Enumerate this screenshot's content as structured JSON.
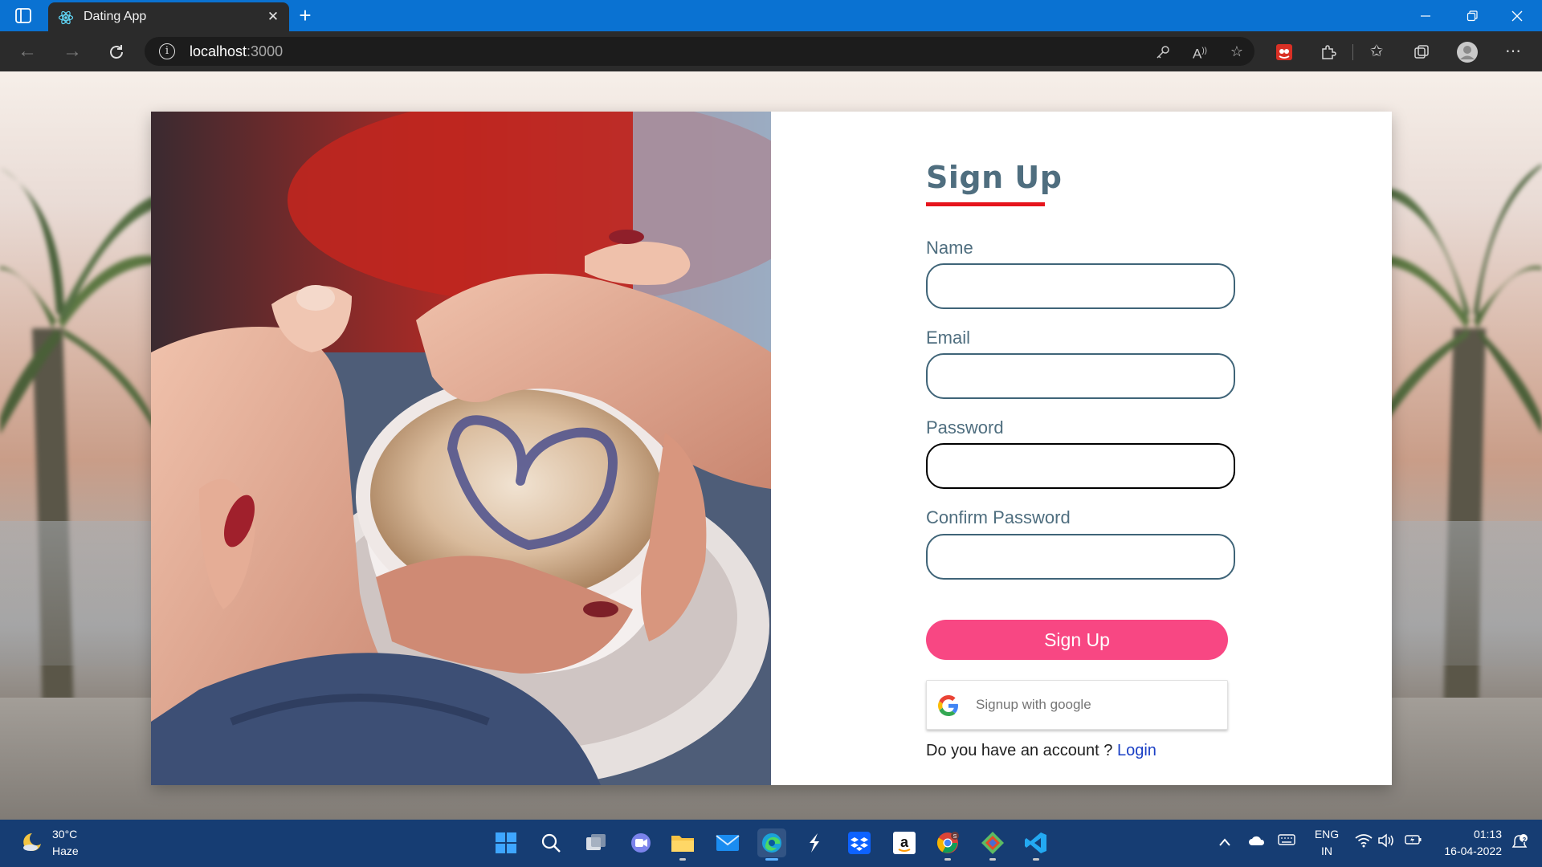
{
  "browser": {
    "tab_title": "Dating App",
    "url_host": "localhost",
    "url_port": ":3000"
  },
  "icons": {
    "tab_actions": "tab-actions-icon",
    "favicon": "react-icon",
    "close": "close-icon",
    "new_tab": "plus-icon",
    "back": "back-arrow-icon",
    "forward": "forward-arrow-icon",
    "refresh": "refresh-icon",
    "info": "info-icon",
    "key": "key-icon",
    "read_aloud": "read-aloud-icon",
    "add_favorite": "add-favorite-icon",
    "extension_red": "extension-icon",
    "extensions": "puzzle-icon",
    "favorites": "favorites-icon",
    "collections": "collections-icon",
    "profile": "profile-icon",
    "more": "more-icon",
    "google": "google-g-icon"
  },
  "form": {
    "title": "Sign Up",
    "name_label": "Name",
    "email_label": "Email",
    "password_label": "Password",
    "confirm_label": "Confirm Password",
    "name_value": "",
    "email_value": "",
    "password_value": "",
    "confirm_value": "",
    "submit_label": "Sign Up",
    "google_label": "Signup with google",
    "account_prompt": "Do you have an account ? ",
    "login_label": "Login"
  },
  "taskbar": {
    "temperature": "30°C",
    "weather": "Haze",
    "language": "ENG",
    "region": "IN",
    "time": "01:13",
    "date": "16-04-2022",
    "notification_count": "2"
  },
  "colors": {
    "titlebar": "#0a72d2",
    "toolbar": "#2b2b2b",
    "form_text": "#4f6e7f",
    "title_underline": "#e6141c",
    "signup_button": "#f84783",
    "login_link": "#1a3fc5",
    "taskbar": "#163d73"
  }
}
